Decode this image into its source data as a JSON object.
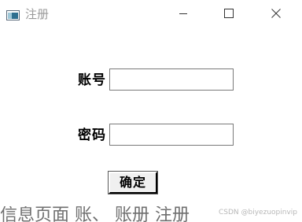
{
  "window": {
    "title": "注册",
    "controls": {
      "minimize_icon": "minimize-icon",
      "maximize_icon": "maximize-icon",
      "close_icon": "close-icon"
    },
    "app_icon": "window-icon"
  },
  "form": {
    "account_label": "账号",
    "account_value": "",
    "password_label": "密码",
    "password_value": "",
    "submit_label": "确定"
  },
  "background": {
    "partial_text": "信息页面 账、 账册 注册  "
  },
  "watermark": {
    "text": "CSDN @biyezuopinvip"
  },
  "colors": {
    "title_text": "#9a9a9a",
    "window_bg": "#ffffff",
    "field_border": "#7a7a7a",
    "button_face": "#f0f0f0"
  }
}
